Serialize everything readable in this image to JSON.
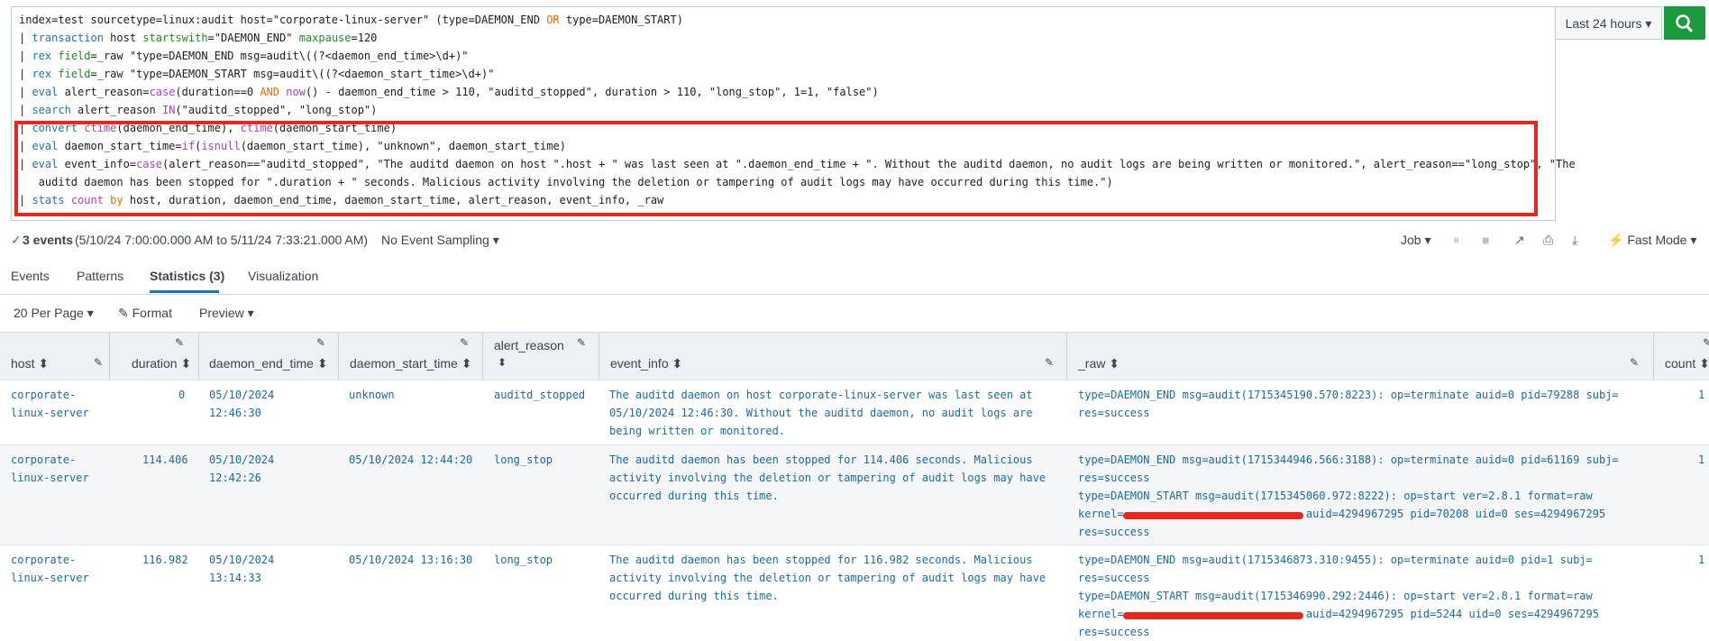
{
  "search": {
    "lines": [
      {
        "parts": [
          {
            "t": "index=test sourcetype=linux:audit host=\"corporate-linux-server\" (type=DAEMON_END ",
            "c": "str"
          },
          {
            "t": "OR",
            "c": "op"
          },
          {
            "t": " type=DAEMON_START)",
            "c": "str"
          }
        ]
      },
      {
        "parts": [
          {
            "t": "| ",
            "c": "str"
          },
          {
            "t": "transaction",
            "c": "kw"
          },
          {
            "t": " host ",
            "c": "str"
          },
          {
            "t": "startswith",
            "c": "arg"
          },
          {
            "t": "=\"DAEMON_END\" ",
            "c": "str"
          },
          {
            "t": "maxpause",
            "c": "arg"
          },
          {
            "t": "=120",
            "c": "str"
          }
        ]
      },
      {
        "parts": [
          {
            "t": "| ",
            "c": "str"
          },
          {
            "t": "rex",
            "c": "kw"
          },
          {
            "t": " ",
            "c": "str"
          },
          {
            "t": "field",
            "c": "arg"
          },
          {
            "t": "=_raw \"type=DAEMON_END msg=audit\\((?<daemon_end_time>\\d+)\"",
            "c": "str"
          }
        ]
      },
      {
        "parts": [
          {
            "t": "| ",
            "c": "str"
          },
          {
            "t": "rex",
            "c": "kw"
          },
          {
            "t": " ",
            "c": "str"
          },
          {
            "t": "field",
            "c": "arg"
          },
          {
            "t": "=_raw \"type=DAEMON_START msg=audit\\((?<daemon_start_time>\\d+)\"",
            "c": "str"
          }
        ]
      },
      {
        "parts": [
          {
            "t": "| ",
            "c": "str"
          },
          {
            "t": "eval",
            "c": "kw"
          },
          {
            "t": " alert_reason=",
            "c": "str"
          },
          {
            "t": "case",
            "c": "fn"
          },
          {
            "t": "(duration==0 ",
            "c": "str"
          },
          {
            "t": "AND",
            "c": "op"
          },
          {
            "t": " ",
            "c": "str"
          },
          {
            "t": "now",
            "c": "fn"
          },
          {
            "t": "() - daemon_end_time > 110, \"auditd_stopped\", duration > 110, \"long_stop\", 1=1, \"false\")",
            "c": "str"
          }
        ]
      },
      {
        "parts": [
          {
            "t": "| ",
            "c": "str"
          },
          {
            "t": "search",
            "c": "kw"
          },
          {
            "t": " alert_reason ",
            "c": "str"
          },
          {
            "t": "IN",
            "c": "fn"
          },
          {
            "t": "(\"auditd_stopped\", \"long_stop\")",
            "c": "str"
          }
        ]
      },
      {
        "parts": [
          {
            "t": "| ",
            "c": "str"
          },
          {
            "t": "convert",
            "c": "kw"
          },
          {
            "t": " ",
            "c": "str"
          },
          {
            "t": "ctime",
            "c": "fn"
          },
          {
            "t": "(daemon_end_time), ",
            "c": "str"
          },
          {
            "t": "ctime",
            "c": "fn"
          },
          {
            "t": "(daemon_start_time)",
            "c": "str"
          }
        ]
      },
      {
        "parts": [
          {
            "t": "| ",
            "c": "str"
          },
          {
            "t": "eval",
            "c": "kw"
          },
          {
            "t": " daemon_start_time=",
            "c": "str"
          },
          {
            "t": "if",
            "c": "fn"
          },
          {
            "t": "(",
            "c": "str"
          },
          {
            "t": "isnull",
            "c": "fn"
          },
          {
            "t": "(daemon_start_time), \"unknown\", daemon_start_time)",
            "c": "str"
          }
        ]
      },
      {
        "parts": [
          {
            "t": "| ",
            "c": "str"
          },
          {
            "t": "eval",
            "c": "kw"
          },
          {
            "t": " event_info=",
            "c": "str"
          },
          {
            "t": "case",
            "c": "fn"
          },
          {
            "t": "(alert_reason==\"auditd_stopped\", \"The auditd daemon on host \".host + \" was last seen at \".daemon_end_time + \". Without the auditd daemon, no audit logs are being written or monitored.\", alert_reason==\"long_stop\", \"The",
            "c": "str"
          }
        ]
      },
      {
        "parts": [
          {
            "t": "   auditd daemon has been stopped for \".duration + \" seconds. Malicious activity involving the deletion or tampering of audit logs may have occurred during this time.\")",
            "c": "str"
          }
        ]
      },
      {
        "parts": [
          {
            "t": "| ",
            "c": "str"
          },
          {
            "t": "stats",
            "c": "kw"
          },
          {
            "t": " ",
            "c": "str"
          },
          {
            "t": "count",
            "c": "fn"
          },
          {
            "t": " ",
            "c": "str"
          },
          {
            "t": "by",
            "c": "op"
          },
          {
            "t": " host, duration, daemon_end_time, daemon_start_time, alert_reason, event_info, _raw",
            "c": "str"
          }
        ]
      }
    ],
    "time_range": "Last 24 hours ▾",
    "search_icon": "search-icon"
  },
  "status": {
    "events": "3 events",
    "range": "(5/10/24 7:00:00.000 AM to 5/11/24 7:33:21.000 AM)",
    "sampling": "No Event Sampling ▾",
    "job": "Job ▾",
    "mode": "⚡ Fast Mode ▾"
  },
  "tabs": [
    "Events",
    "Patterns",
    "Statistics (3)",
    "Visualization"
  ],
  "options": {
    "per_page": "20 Per Page ▾",
    "format": "✎ Format",
    "preview": "Preview ▾"
  },
  "table": {
    "columns": [
      {
        "label": "host ⬍"
      },
      {
        "label": "duration ⬍"
      },
      {
        "label": "daemon_end_time ⬍"
      },
      {
        "label": "daemon_start_time ⬍"
      },
      {
        "label": "alert_reason"
      },
      {
        "label": "event_info ⬍"
      },
      {
        "label": "_raw ⬍"
      },
      {
        "label": "count ⬍"
      }
    ],
    "sort_glyph": "⬍",
    "rows": [
      {
        "host": "corporate-\nlinux-server",
        "duration": "0",
        "end": "05/10/2024\n12:46:30",
        "start": "unknown",
        "reason": "auditd_stopped",
        "info": "The auditd daemon on host corporate-linux-server was last seen at\n05/10/2024 12:46:30. Without the auditd daemon, no audit logs are\nbeing written or monitored.",
        "raw": "type=DAEMON_END msg=audit(1715345190.570:8223): op=terminate auid=0 pid=79288 subj=\nres=success",
        "count": "1"
      },
      {
        "host": "corporate-\nlinux-server",
        "duration": "114.406",
        "end": "05/10/2024\n12:42:26",
        "start": "05/10/2024 12:44:20",
        "reason": "long_stop",
        "info": "The auditd daemon has been stopped for 114.406 seconds. Malicious\nactivity involving the deletion or tampering of audit logs may have\noccurred during this time.",
        "raw": "type=DAEMON_END msg=audit(1715344946.566:3188): op=terminate auid=0 pid=61169 subj=\nres=success\ntype=DAEMON_START msg=audit(1715345060.972:8222): op=start ver=2.8.1 format=raw\nkernel=                            auid=4294967295 pid=70208 uid=0 ses=4294967295\nres=success",
        "count": "1"
      },
      {
        "host": "corporate-\nlinux-server",
        "duration": "116.982",
        "end": "05/10/2024\n13:14:33",
        "start": "05/10/2024 13:16:30",
        "reason": "long_stop",
        "info": "The auditd daemon has been stopped for 116.982 seconds. Malicious\nactivity involving the deletion or tampering of audit logs may have\noccurred during this time.",
        "raw": "type=DAEMON_END msg=audit(1715346873.310:9455): op=terminate auid=0 pid=1 subj=\nres=success\ntype=DAEMON_START msg=audit(1715346990.292:2446): op=start ver=2.8.1 format=raw\nkernel=                            auid=4294967295 pid=5244 uid=0 ses=4294967295\nres=success",
        "count": "1"
      }
    ]
  },
  "colors": {
    "accent": "#1a73bb",
    "highlight": "#e8261a",
    "search_button": "#1a9c3e",
    "cell_text": "#1a6aa8"
  }
}
